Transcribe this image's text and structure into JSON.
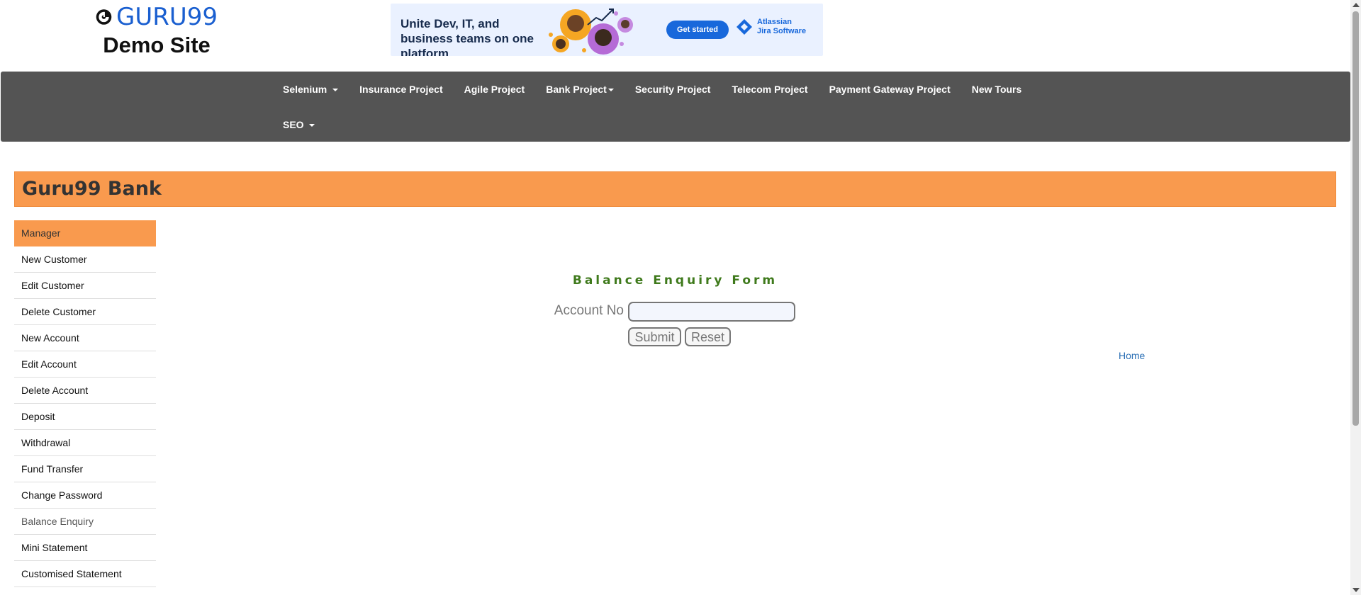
{
  "logo": {
    "brand": "GURU99",
    "subtitle": "Demo Site"
  },
  "ad": {
    "text": "Unite Dev, IT, and business teams on one platform",
    "button": "Get started",
    "brand_line1": "Atlassian",
    "brand_line2": "Jira Software"
  },
  "nav": {
    "items": [
      {
        "label": "Selenium",
        "dropdown": true
      },
      {
        "label": "Insurance Project",
        "dropdown": false
      },
      {
        "label": "Agile Project",
        "dropdown": false
      },
      {
        "label": "Bank Project",
        "dropdown": true
      },
      {
        "label": "Security Project",
        "dropdown": false
      },
      {
        "label": "Telecom Project",
        "dropdown": false
      },
      {
        "label": "Payment Gateway Project",
        "dropdown": false
      },
      {
        "label": "New Tours",
        "dropdown": false
      },
      {
        "label": "SEO",
        "dropdown": true
      }
    ]
  },
  "bank": {
    "title": "Guru99 Bank"
  },
  "sidebar": {
    "items": [
      {
        "label": "Manager"
      },
      {
        "label": "New Customer"
      },
      {
        "label": "Edit Customer"
      },
      {
        "label": "Delete Customer"
      },
      {
        "label": "New Account"
      },
      {
        "label": "Edit Account"
      },
      {
        "label": "Delete Account"
      },
      {
        "label": "Deposit"
      },
      {
        "label": "Withdrawal"
      },
      {
        "label": "Fund Transfer"
      },
      {
        "label": "Change Password"
      },
      {
        "label": "Balance Enquiry"
      },
      {
        "label": "Mini Statement"
      },
      {
        "label": "Customised Statement"
      }
    ]
  },
  "form": {
    "title": "Balance Enquiry Form",
    "account_label": "Account No",
    "account_value": "",
    "submit": "Submit",
    "reset": "Reset",
    "home_link": "Home"
  },
  "colors": {
    "accent": "#f99a4e",
    "navbar": "#545454",
    "form_title": "#3f7a1c",
    "link": "#2a6fb5"
  }
}
